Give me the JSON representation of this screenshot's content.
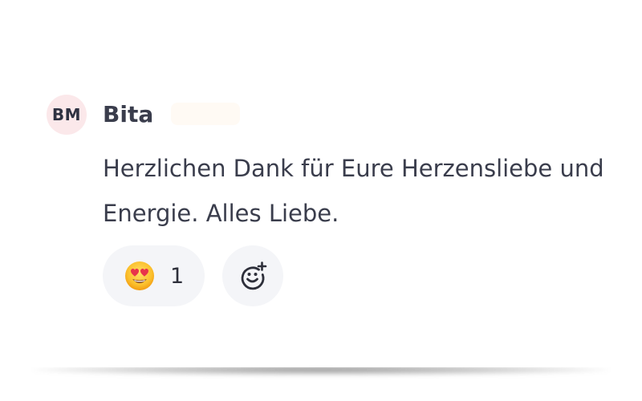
{
  "comment": {
    "avatar_initials": "BM",
    "author": "Bita",
    "text": "Herzlichen Dank für Eure Herzensliebe und Energie. Alles Liebe.",
    "reactions": [
      {
        "icon": "heart-eyes-emoji-icon",
        "count": "1"
      }
    ],
    "add_reaction_icon": "add-emoji-icon"
  },
  "colors": {
    "avatar_bg": "#fbe8ea",
    "text": "#3a3d4c",
    "pill_bg": "#f4f5f8"
  }
}
